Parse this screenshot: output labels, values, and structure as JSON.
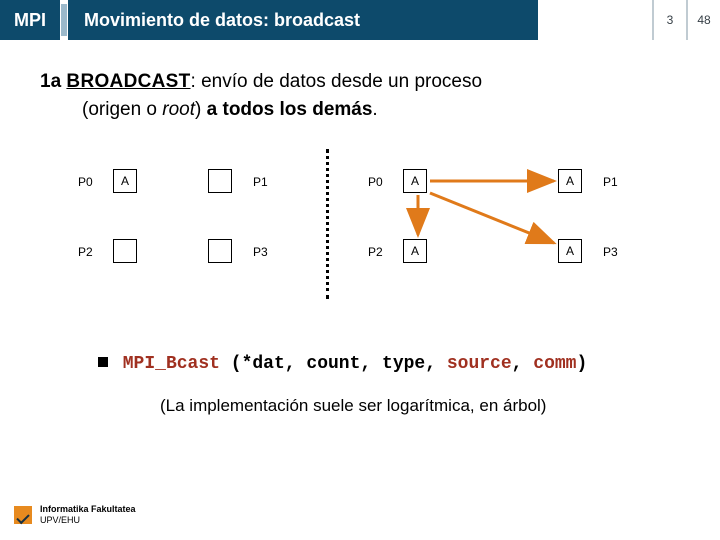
{
  "header": {
    "left": "MPI",
    "title": "Movimiento de datos: broadcast",
    "page_current": "3",
    "page_total": "48"
  },
  "heading": {
    "tag": "1a",
    "keyword": "BROADCAST",
    "text1": ": envío de datos desde un proceso",
    "indent_pre": "(origen o ",
    "root_word": "root",
    "indent_post": ") ",
    "bold_tail": "a todos los demás",
    "period": "."
  },
  "diagram": {
    "left": {
      "p0_label": "P0",
      "p0_val": "A",
      "p1_label": "P1",
      "p2_label": "P2",
      "p3_label": "P3"
    },
    "right": {
      "p0_label": "P0",
      "p0_val": "A",
      "p1_label": "P1",
      "p1_val": "A",
      "p2_label": "P2",
      "p2_val": "A",
      "p3_label": "P3",
      "p3_val": "A"
    }
  },
  "fn": {
    "name": "MPI_Bcast",
    "open": " (",
    "args_dat": "*dat",
    "sep": ", ",
    "args_count": "count",
    "args_type": "type",
    "args_source": "source",
    "args_comm": "comm",
    "close": ")"
  },
  "impl_note": "(La implementación suele ser logarítmica, en árbol)",
  "footer": {
    "line1": "Informatika Fakultatea",
    "line2": "UPV/EHU"
  }
}
